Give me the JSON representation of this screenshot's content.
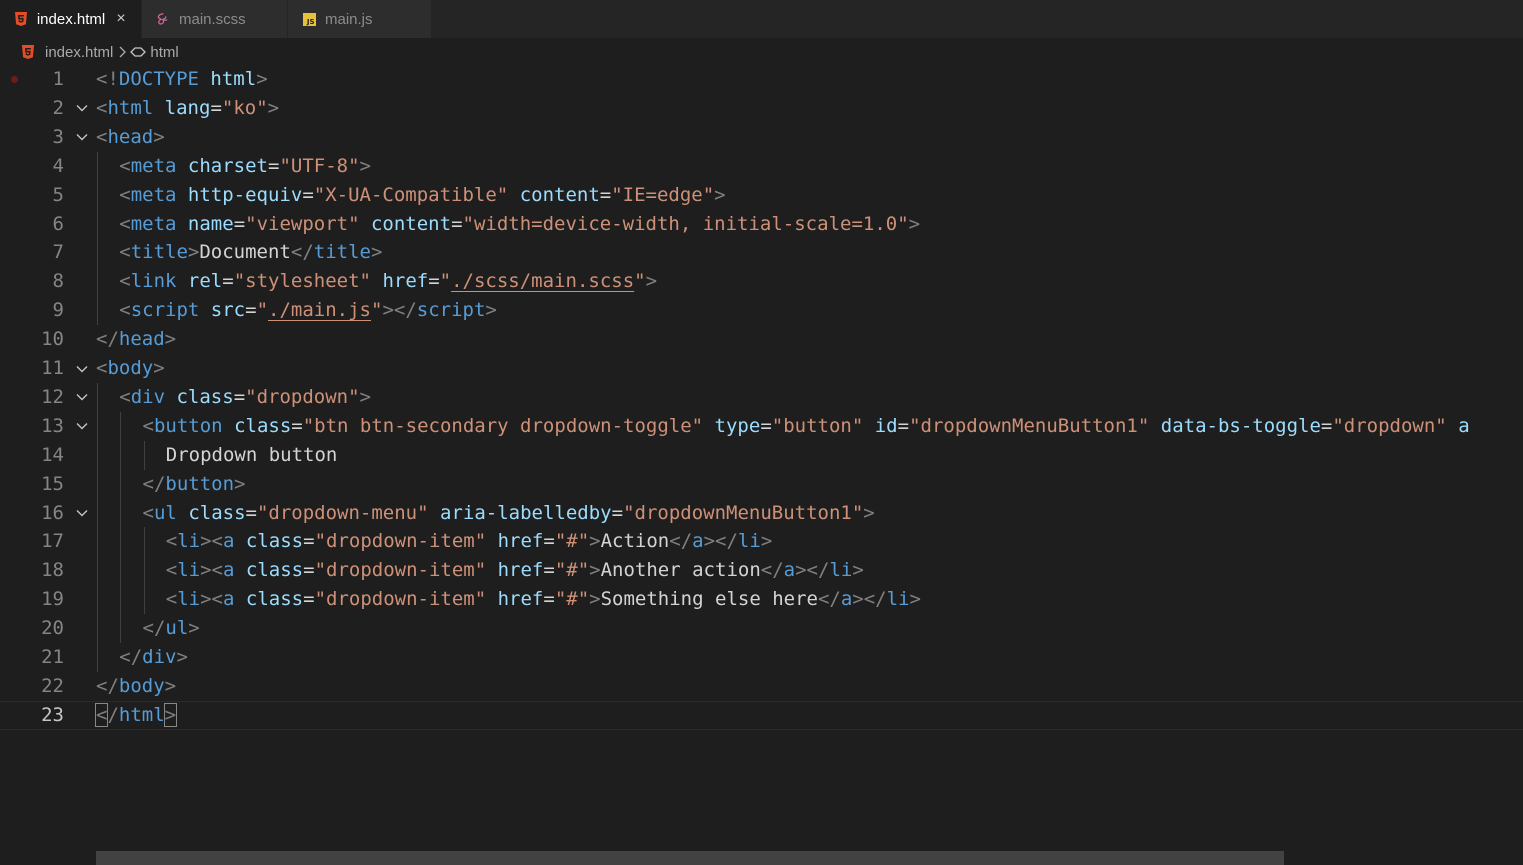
{
  "tabs": [
    {
      "label": "index.html",
      "icon": "html5-icon",
      "active": true,
      "closable": true
    },
    {
      "label": "main.scss",
      "icon": "sass-icon",
      "active": false
    },
    {
      "label": "main.js",
      "icon": "js-icon",
      "active": false
    }
  ],
  "breadcrumb": {
    "file": "index.html",
    "symbol": "html"
  },
  "editor": {
    "current_line": 23,
    "lines": [
      {
        "n": "1",
        "tokens": [
          [
            "p",
            "<!"
          ],
          [
            "tag",
            "DOCTYPE"
          ],
          [
            "txt",
            " "
          ],
          [
            "attr",
            "html"
          ],
          [
            "p",
            ">"
          ]
        ]
      },
      {
        "n": "2",
        "fold": true,
        "tokens": [
          [
            "p",
            "<"
          ],
          [
            "tag",
            "html"
          ],
          [
            "txt",
            " "
          ],
          [
            "attr",
            "lang"
          ],
          [
            "eq",
            "="
          ],
          [
            "str",
            "\"ko\""
          ],
          [
            "p",
            ">"
          ]
        ]
      },
      {
        "n": "3",
        "fold": true,
        "tokens": [
          [
            "p",
            "<"
          ],
          [
            "tag",
            "head"
          ],
          [
            "p",
            ">"
          ]
        ]
      },
      {
        "n": "4",
        "indent": 1,
        "tokens": [
          [
            "p",
            "<"
          ],
          [
            "tag",
            "meta"
          ],
          [
            "txt",
            " "
          ],
          [
            "attr",
            "charset"
          ],
          [
            "eq",
            "="
          ],
          [
            "str",
            "\"UTF-8\""
          ],
          [
            "p",
            ">"
          ]
        ]
      },
      {
        "n": "5",
        "indent": 1,
        "tokens": [
          [
            "p",
            "<"
          ],
          [
            "tag",
            "meta"
          ],
          [
            "txt",
            " "
          ],
          [
            "attr",
            "http-equiv"
          ],
          [
            "eq",
            "="
          ],
          [
            "str",
            "\"X-UA-Compatible\""
          ],
          [
            "txt",
            " "
          ],
          [
            "attr",
            "content"
          ],
          [
            "eq",
            "="
          ],
          [
            "str",
            "\"IE=edge\""
          ],
          [
            "p",
            ">"
          ]
        ]
      },
      {
        "n": "6",
        "indent": 1,
        "tokens": [
          [
            "p",
            "<"
          ],
          [
            "tag",
            "meta"
          ],
          [
            "txt",
            " "
          ],
          [
            "attr",
            "name"
          ],
          [
            "eq",
            "="
          ],
          [
            "str",
            "\"viewport\""
          ],
          [
            "txt",
            " "
          ],
          [
            "attr",
            "content"
          ],
          [
            "eq",
            "="
          ],
          [
            "str",
            "\"width=device-width, initial-scale=1.0\""
          ],
          [
            "p",
            ">"
          ]
        ]
      },
      {
        "n": "7",
        "indent": 1,
        "tokens": [
          [
            "p",
            "<"
          ],
          [
            "tag",
            "title"
          ],
          [
            "p",
            ">"
          ],
          [
            "txt",
            "Document"
          ],
          [
            "p",
            "</"
          ],
          [
            "tag",
            "title"
          ],
          [
            "p",
            ">"
          ]
        ]
      },
      {
        "n": "8",
        "indent": 1,
        "tokens": [
          [
            "p",
            "<"
          ],
          [
            "tag",
            "link"
          ],
          [
            "txt",
            " "
          ],
          [
            "attr",
            "rel"
          ],
          [
            "eq",
            "="
          ],
          [
            "str",
            "\"stylesheet\""
          ],
          [
            "txt",
            " "
          ],
          [
            "attr",
            "href"
          ],
          [
            "eq",
            "="
          ],
          [
            "str",
            "\""
          ],
          [
            "strlink",
            "./scss/main.scss"
          ],
          [
            "str",
            "\""
          ],
          [
            "p",
            ">"
          ]
        ]
      },
      {
        "n": "9",
        "indent": 1,
        "tokens": [
          [
            "p",
            "<"
          ],
          [
            "tag",
            "script"
          ],
          [
            "txt",
            " "
          ],
          [
            "attr",
            "src"
          ],
          [
            "eq",
            "="
          ],
          [
            "str",
            "\""
          ],
          [
            "strlink",
            "./main.js"
          ],
          [
            "str",
            "\""
          ],
          [
            "p",
            "></"
          ],
          [
            "tag",
            "script"
          ],
          [
            "p",
            ">"
          ]
        ]
      },
      {
        "n": "10",
        "tokens": [
          [
            "p",
            "</"
          ],
          [
            "tag",
            "head"
          ],
          [
            "p",
            ">"
          ]
        ]
      },
      {
        "n": "11",
        "fold": true,
        "tokens": [
          [
            "p",
            "<"
          ],
          [
            "tag",
            "body"
          ],
          [
            "p",
            ">"
          ]
        ]
      },
      {
        "n": "12",
        "fold": true,
        "indent": 1,
        "tokens": [
          [
            "p",
            "<"
          ],
          [
            "tag",
            "div"
          ],
          [
            "txt",
            " "
          ],
          [
            "attr",
            "class"
          ],
          [
            "eq",
            "="
          ],
          [
            "str",
            "\"dropdown\""
          ],
          [
            "p",
            ">"
          ]
        ]
      },
      {
        "n": "13",
        "fold": true,
        "indent": 2,
        "tokens": [
          [
            "p",
            "<"
          ],
          [
            "tag",
            "button"
          ],
          [
            "txt",
            " "
          ],
          [
            "attr",
            "class"
          ],
          [
            "eq",
            "="
          ],
          [
            "str",
            "\"btn btn-secondary dropdown-toggle\""
          ],
          [
            "txt",
            " "
          ],
          [
            "attr",
            "type"
          ],
          [
            "eq",
            "="
          ],
          [
            "str",
            "\"button\""
          ],
          [
            "txt",
            " "
          ],
          [
            "attr",
            "id"
          ],
          [
            "eq",
            "="
          ],
          [
            "str",
            "\"dropdownMenuButton1\""
          ],
          [
            "txt",
            " "
          ],
          [
            "attr",
            "data-bs-toggle"
          ],
          [
            "eq",
            "="
          ],
          [
            "str",
            "\"dropdown\""
          ],
          [
            "txt",
            " "
          ],
          [
            "attr",
            "a"
          ]
        ]
      },
      {
        "n": "14",
        "indent": 3,
        "tokens": [
          [
            "txt",
            "Dropdown button"
          ]
        ]
      },
      {
        "n": "15",
        "indent": 2,
        "tokens": [
          [
            "p",
            "</"
          ],
          [
            "tag",
            "button"
          ],
          [
            "p",
            ">"
          ]
        ]
      },
      {
        "n": "16",
        "fold": true,
        "indent": 2,
        "tokens": [
          [
            "p",
            "<"
          ],
          [
            "tag",
            "ul"
          ],
          [
            "txt",
            " "
          ],
          [
            "attr",
            "class"
          ],
          [
            "eq",
            "="
          ],
          [
            "str",
            "\"dropdown-menu\""
          ],
          [
            "txt",
            " "
          ],
          [
            "attr",
            "aria-labelledby"
          ],
          [
            "eq",
            "="
          ],
          [
            "str",
            "\"dropdownMenuButton1\""
          ],
          [
            "p",
            ">"
          ]
        ]
      },
      {
        "n": "17",
        "indent": 3,
        "tokens": [
          [
            "p",
            "<"
          ],
          [
            "tag",
            "li"
          ],
          [
            "p",
            "><"
          ],
          [
            "tag",
            "a"
          ],
          [
            "txt",
            " "
          ],
          [
            "attr",
            "class"
          ],
          [
            "eq",
            "="
          ],
          [
            "str",
            "\"dropdown-item\""
          ],
          [
            "txt",
            " "
          ],
          [
            "attr",
            "href"
          ],
          [
            "eq",
            "="
          ],
          [
            "str",
            "\"#\""
          ],
          [
            "p",
            ">"
          ],
          [
            "txt",
            "Action"
          ],
          [
            "p",
            "</"
          ],
          [
            "tag",
            "a"
          ],
          [
            "p",
            "></"
          ],
          [
            "tag",
            "li"
          ],
          [
            "p",
            ">"
          ]
        ]
      },
      {
        "n": "18",
        "indent": 3,
        "tokens": [
          [
            "p",
            "<"
          ],
          [
            "tag",
            "li"
          ],
          [
            "p",
            "><"
          ],
          [
            "tag",
            "a"
          ],
          [
            "txt",
            " "
          ],
          [
            "attr",
            "class"
          ],
          [
            "eq",
            "="
          ],
          [
            "str",
            "\"dropdown-item\""
          ],
          [
            "txt",
            " "
          ],
          [
            "attr",
            "href"
          ],
          [
            "eq",
            "="
          ],
          [
            "str",
            "\"#\""
          ],
          [
            "p",
            ">"
          ],
          [
            "txt",
            "Another action"
          ],
          [
            "p",
            "</"
          ],
          [
            "tag",
            "a"
          ],
          [
            "p",
            "></"
          ],
          [
            "tag",
            "li"
          ],
          [
            "p",
            ">"
          ]
        ]
      },
      {
        "n": "19",
        "indent": 3,
        "tokens": [
          [
            "p",
            "<"
          ],
          [
            "tag",
            "li"
          ],
          [
            "p",
            "><"
          ],
          [
            "tag",
            "a"
          ],
          [
            "txt",
            " "
          ],
          [
            "attr",
            "class"
          ],
          [
            "eq",
            "="
          ],
          [
            "str",
            "\"dropdown-item\""
          ],
          [
            "txt",
            " "
          ],
          [
            "attr",
            "href"
          ],
          [
            "eq",
            "="
          ],
          [
            "str",
            "\"#\""
          ],
          [
            "p",
            ">"
          ],
          [
            "txt",
            "Something else here"
          ],
          [
            "p",
            "</"
          ],
          [
            "tag",
            "a"
          ],
          [
            "p",
            "></"
          ],
          [
            "tag",
            "li"
          ],
          [
            "p",
            ">"
          ]
        ]
      },
      {
        "n": "20",
        "indent": 2,
        "tokens": [
          [
            "p",
            "</"
          ],
          [
            "tag",
            "ul"
          ],
          [
            "p",
            ">"
          ]
        ]
      },
      {
        "n": "21",
        "indent": 1,
        "tokens": [
          [
            "p",
            "</"
          ],
          [
            "tag",
            "div"
          ],
          [
            "p",
            ">"
          ]
        ]
      },
      {
        "n": "22",
        "tokens": [
          [
            "p",
            "</"
          ],
          [
            "tag",
            "body"
          ],
          [
            "p",
            ">"
          ]
        ]
      },
      {
        "n": "23",
        "tokens": [
          [
            "phl",
            "<"
          ],
          [
            "p",
            "/"
          ],
          [
            "tag",
            "html"
          ],
          [
            "phl",
            ">"
          ]
        ]
      }
    ]
  },
  "colors": {
    "background": "#1e1e1e",
    "tag": "#569cd6",
    "attribute": "#9cdcfe",
    "string": "#ce9178",
    "punctuation": "#808080",
    "text": "#d4d4d4",
    "breakpoint": "#6e1b1b"
  }
}
